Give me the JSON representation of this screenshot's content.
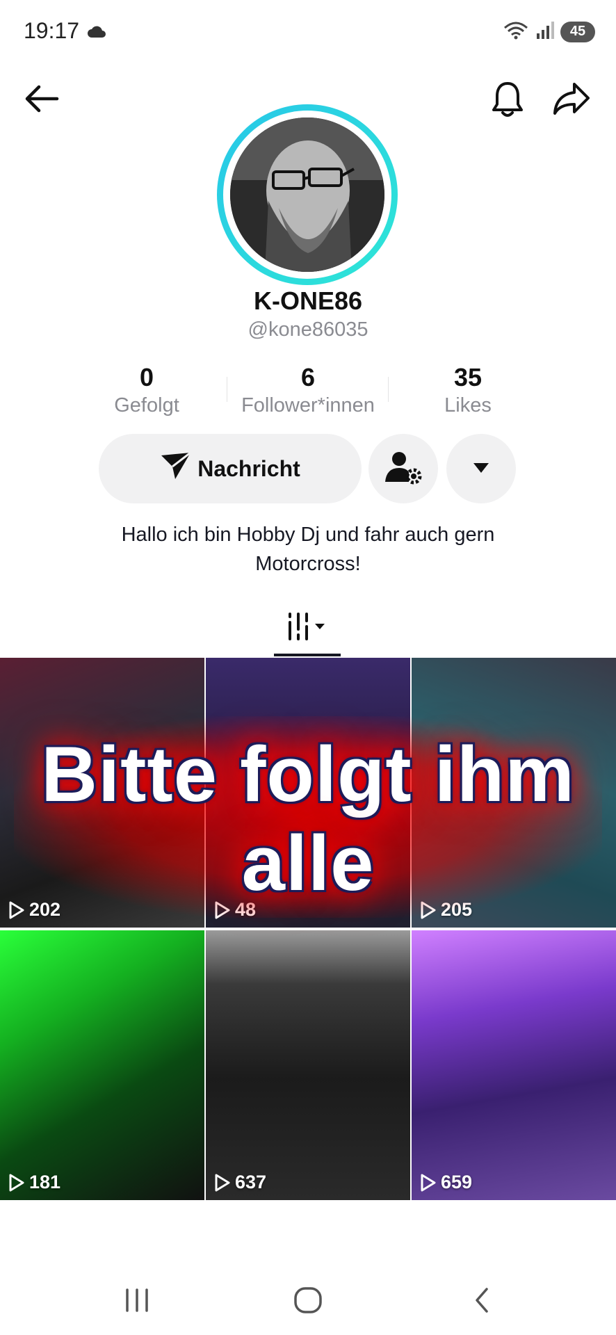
{
  "status_bar": {
    "time": "19:17",
    "battery": "45"
  },
  "profile": {
    "display_name": "K-ONE86",
    "username": "@kone86035",
    "bio_line1": "Hallo ich bin Hobby Dj und fahr auch gern",
    "bio_line2": "Motorcross!"
  },
  "stats": [
    {
      "value": "0",
      "label": "Gefolgt"
    },
    {
      "value": "6",
      "label": "Follower*innen"
    },
    {
      "value": "35",
      "label": "Likes"
    }
  ],
  "actions": {
    "message_label": "Nachricht"
  },
  "overlay": {
    "line1": "Bitte folgt ihm",
    "line2": "alle"
  },
  "videos": [
    {
      "views": "202"
    },
    {
      "views": "48"
    },
    {
      "views": "205"
    },
    {
      "views": "181"
    },
    {
      "views": "637"
    },
    {
      "views": "659"
    }
  ],
  "colors": {
    "ring_start": "#28c7e8",
    "ring_end": "#2ee6d6",
    "overlay_glow": "#ff0000",
    "overlay_outline": "#1d1d5a"
  }
}
